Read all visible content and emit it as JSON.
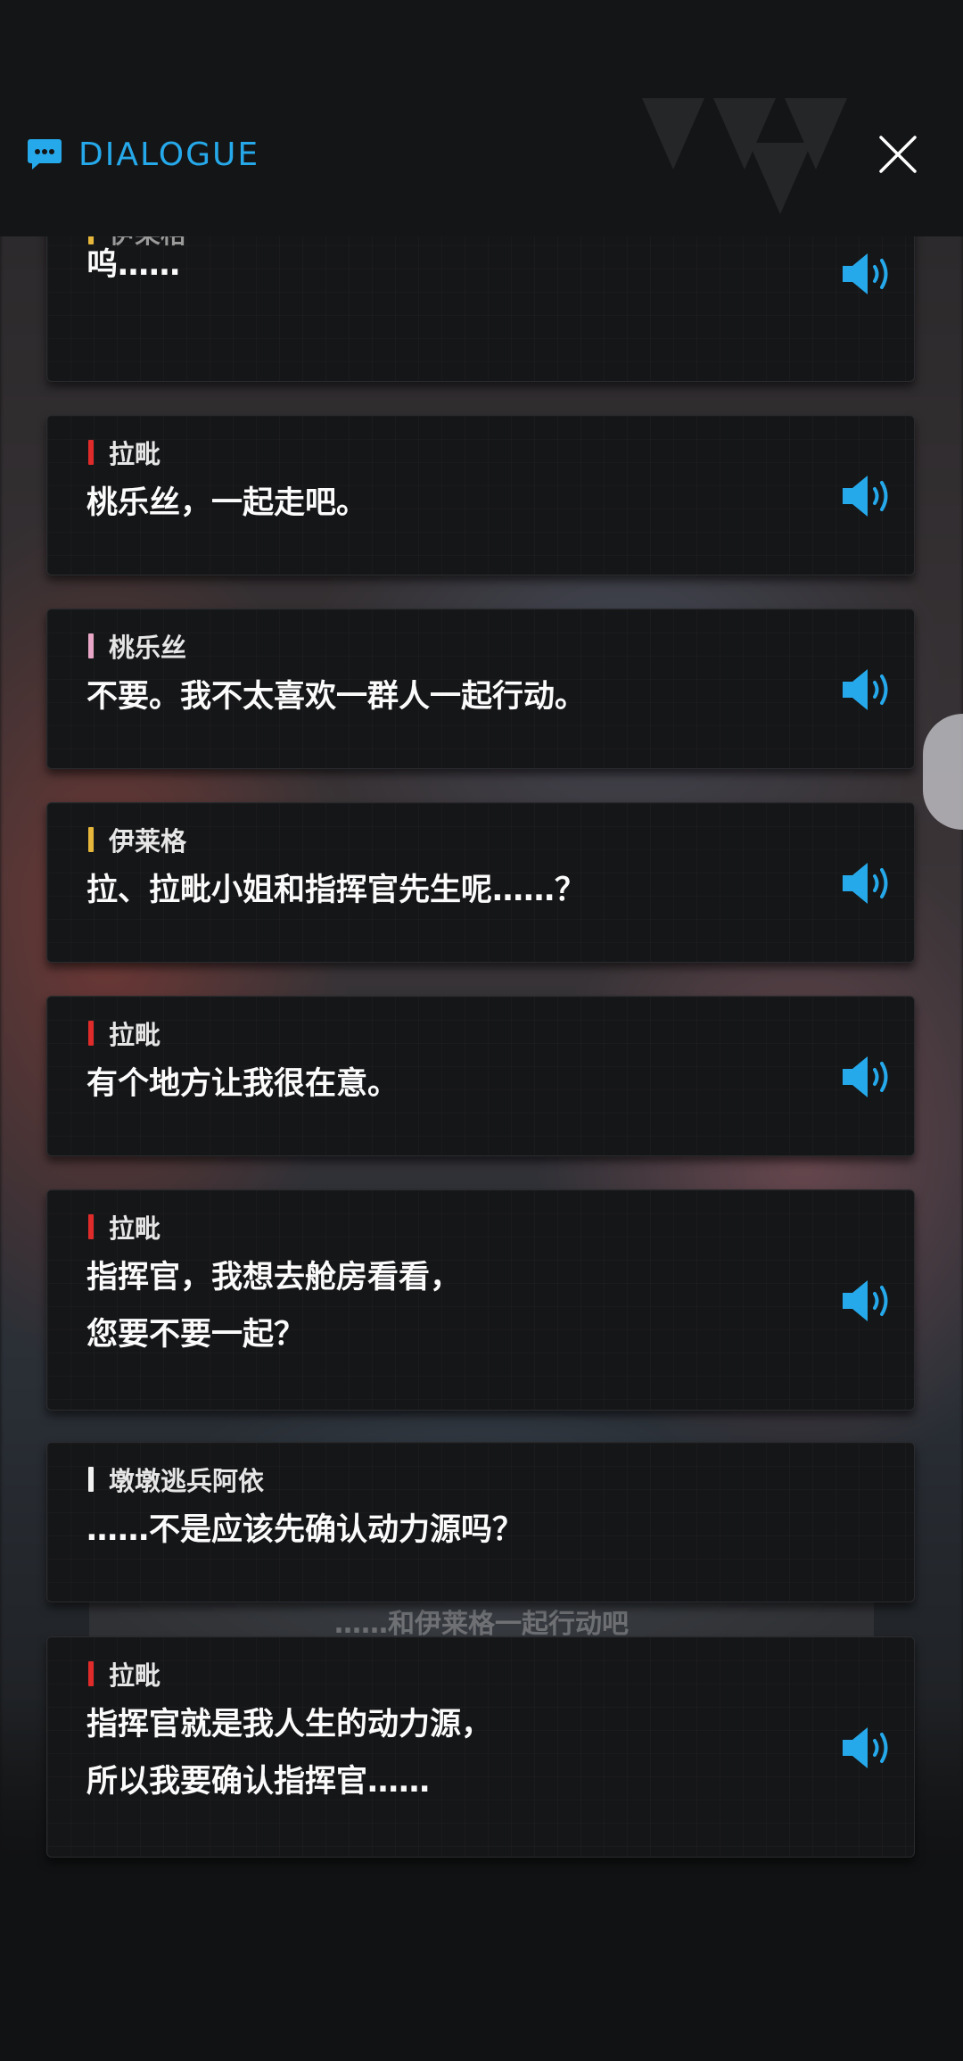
{
  "header": {
    "title": "DIALOGUE",
    "chat_icon": "chat-bubble-icon",
    "close_icon": "close-icon"
  },
  "colors": {
    "accent": "#26a9ea",
    "speaker_bars": {
      "伊莱格": "#e6b73a",
      "拉毗": "#e02b2b",
      "桃乐丝": "#e9a7c7",
      "墩墩逃兵阿依": "#f2f2f2"
    }
  },
  "background_option": "……和伊莱格一起行动吧",
  "dialogues": [
    {
      "speaker": "伊莱格",
      "lines": [
        "呜……"
      ],
      "bar_color": "#e6b73a",
      "has_voice": true
    },
    {
      "speaker": "拉毗",
      "lines": [
        "桃乐丝，一起走吧。"
      ],
      "bar_color": "#e02b2b",
      "has_voice": true
    },
    {
      "speaker": "桃乐丝",
      "lines": [
        "不要。我不太喜欢一群人一起行动。"
      ],
      "bar_color": "#e9a7c7",
      "has_voice": true
    },
    {
      "speaker": "伊莱格",
      "lines": [
        "拉、拉毗小姐和指挥官先生呢……？"
      ],
      "bar_color": "#e6b73a",
      "has_voice": true
    },
    {
      "speaker": "拉毗",
      "lines": [
        "有个地方让我很在意。"
      ],
      "bar_color": "#e02b2b",
      "has_voice": true
    },
    {
      "speaker": "拉毗",
      "lines": [
        "指挥官，我想去舱房看看，",
        "您要不要一起？"
      ],
      "bar_color": "#e02b2b",
      "has_voice": true
    },
    {
      "speaker": "墩墩逃兵阿依",
      "lines": [
        "……不是应该先确认动力源吗？"
      ],
      "bar_color": "#f2f2f2",
      "has_voice": false
    },
    {
      "speaker": "拉毗",
      "lines": [
        "指挥官就是我人生的动力源，",
        "所以我要确认指挥官……"
      ],
      "bar_color": "#e02b2b",
      "has_voice": true
    }
  ],
  "voice_icon": "speaker-volume-icon"
}
